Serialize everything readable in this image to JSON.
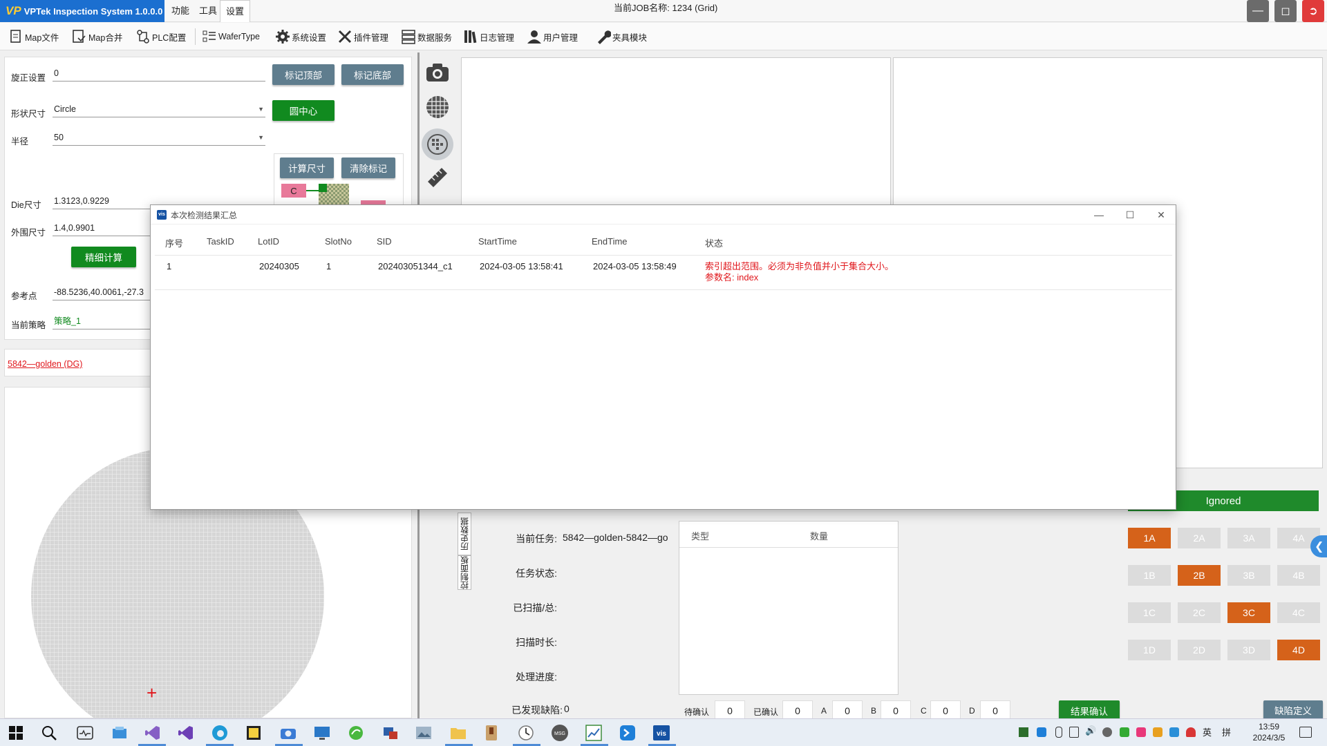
{
  "titlebar": {
    "app_title": "VPTek Inspection System 1.0.0.0",
    "menus": [
      "功能",
      "工具",
      "设置"
    ],
    "job_label": "当前JOB名称:",
    "job_value": "1234 (Grid)"
  },
  "toolbar": {
    "items": [
      {
        "label": "Map文件",
        "icon": "document-icon"
      },
      {
        "label": "Map合并",
        "icon": "merge-icon"
      },
      {
        "label": "PLC配置",
        "icon": "plc-icon"
      },
      {
        "label": "WaferType",
        "icon": "list-icon"
      },
      {
        "label": "系统设置",
        "icon": "gear-icon"
      },
      {
        "label": "插件管理",
        "icon": "tools-icon"
      },
      {
        "label": "数据服务",
        "icon": "database-icon"
      },
      {
        "label": "日志管理",
        "icon": "books-icon"
      },
      {
        "label": "用户管理",
        "icon": "user-icon"
      },
      {
        "label": "夹具模块",
        "icon": "wrench-icon"
      }
    ]
  },
  "left_panel": {
    "rotation_label": "旋正设置",
    "rotation_value": "0",
    "mark_top_btn": "标记顶部",
    "mark_bottom_btn": "标记底部",
    "shape_label": "形状尺寸",
    "shape_value": "Circle",
    "circle_center_btn": "圆中心",
    "radius_label": "半径",
    "radius_value": "50",
    "calc_size_btn": "计算尺寸",
    "clear_mark_btn": "清除标记",
    "c_tag": "C",
    "die_label": "Die尺寸",
    "die_value": "1.3123,0.9229",
    "outer_label": "外围尺寸",
    "outer_value": "1.4,0.9901",
    "fine_calc_btn": "精细计算",
    "ref_label": "参考点",
    "ref_value": "-88.5236,40.0061,-27.3",
    "strategy_label": "当前策略",
    "strategy_value": "策略_1",
    "golden_link": "5842—golden (DG)"
  },
  "center": {
    "vtabs": [
      "历史数据",
      "控制面板"
    ],
    "task_label": "当前任务:",
    "task_value": "5842—golden-5842—go",
    "status_label": "任务状态:",
    "scanned_label": "已扫描/总:",
    "duration_label": "扫描时长:",
    "progress_label": "处理进度:",
    "defects_label": "已发现缺陷:",
    "defects_value": "0",
    "table_headers": [
      "类型",
      "数量"
    ],
    "counts": [
      {
        "label": "待确认",
        "value": "0"
      },
      {
        "label": "已确认",
        "value": "0"
      },
      {
        "label": "A",
        "value": "0"
      },
      {
        "label": "B",
        "value": "0"
      },
      {
        "label": "C",
        "value": "0"
      },
      {
        "label": "D",
        "value": "0"
      }
    ],
    "confirm_btn": "结果确认"
  },
  "right": {
    "ignored_btn": "Ignored",
    "grades": [
      [
        "1A",
        "2A",
        "3A",
        "4A"
      ],
      [
        "1B",
        "2B",
        "3B",
        "4B"
      ],
      [
        "1C",
        "2C",
        "3C",
        "4C"
      ],
      [
        "1D",
        "2D",
        "3D",
        "4D"
      ]
    ],
    "defect_def_btn": "缺陷定义"
  },
  "dialog": {
    "icon_text": "vis",
    "title": "本次检测结果汇总",
    "columns": [
      "序号",
      "TaskID",
      "LotID",
      "SlotNo",
      "SID",
      "StartTime",
      "EndTime",
      "状态"
    ],
    "row": {
      "index": "1",
      "task_id": "",
      "lot_id": "20240305",
      "slot_no": "1",
      "sid": "202403051344_c1",
      "start_time": "2024-03-05 13:58:41",
      "end_time": "2024-03-05 13:58:49",
      "status_line1": "索引超出范围。必须为非负值并小于集合大小。",
      "status_line2": "参数名: index"
    }
  },
  "taskbar": {
    "time": "13:59",
    "date": "2024/3/5",
    "ime": "英",
    "ime2": "拼"
  },
  "colors": {
    "accent_blue": "#1b6fd0",
    "green": "#118a1f",
    "orange": "#d5621a",
    "error_red": "#e0161b",
    "btn_gray": "#5f7d8e"
  }
}
